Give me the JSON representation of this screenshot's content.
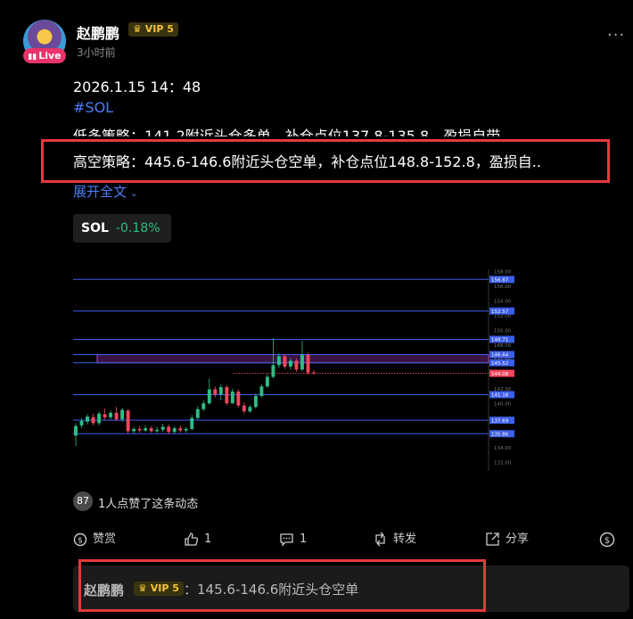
{
  "post": {
    "username": "赵鹏鹏",
    "vip": "VIP 5",
    "vip_icon": "crown-icon",
    "live_label": "Live",
    "time": "3小时前",
    "date_line": "2026.1.15 14：48",
    "hashtag": "#SOL",
    "line_long": "低多策略：141.2附近头仓多单，补仓点位137.8-135.8，盈损自带",
    "line_short": "高空策略：445.6-146.6附近头仓空单，补仓点位148.8-152.8，盈损自..",
    "expand": "展开全文",
    "ticker_symbol": "SOL",
    "ticker_change": "-0.18%",
    "likes_count": "87",
    "likes_text": "1人点赞了这条动态"
  },
  "actions": {
    "reward": "赞赏",
    "like": "1",
    "comment": "1",
    "repost": "转发",
    "share": "分享"
  },
  "comment": {
    "user": "赵鹏鹏",
    "vip": "VIP 5",
    "text": "：145.6-146.6附近头仓空单"
  },
  "colors": {
    "accent": "#4d7cf6",
    "up": "#2ebd85",
    "down": "#f6465d",
    "highlight_box": "#e43a3a",
    "vip": "#f4c23d"
  },
  "chart_data": {
    "type": "candlestick",
    "ylim": [
      132,
      158
    ],
    "y_ticks": [
      "158.00",
      "156.00",
      "154.00",
      "152.00",
      "150.00",
      "148.00",
      "146.00",
      "144.00",
      "142.00",
      "140.00",
      "138.00",
      "136.00",
      "134.00",
      "132.00"
    ],
    "levels": [
      {
        "value": 156.87,
        "label": "156.87"
      },
      {
        "value": 152.57,
        "label": "152.57"
      },
      {
        "value": 148.71,
        "label": "148.71"
      },
      {
        "value": 146.64,
        "label": "146.64"
      },
      {
        "value": 145.52,
        "label": "145.52"
      },
      {
        "value": 144.08,
        "label": "144.08"
      },
      {
        "value": 141.18,
        "label": "141.18"
      },
      {
        "value": 137.69,
        "label": "137.69"
      },
      {
        "value": 135.86,
        "label": "135.86"
      }
    ],
    "current_price": 144.08,
    "zone": [
      145.52,
      146.64
    ],
    "candles": [
      [
        135.6,
        136.9,
        137.3,
        134.2
      ],
      [
        137.0,
        137.6,
        138.0,
        136.6
      ],
      [
        137.5,
        138.2,
        138.5,
        137.1
      ],
      [
        138.1,
        137.3,
        138.6,
        137.0
      ],
      [
        137.3,
        138.6,
        138.9,
        137.0
      ],
      [
        138.5,
        138.1,
        139.3,
        137.8
      ],
      [
        138.1,
        138.7,
        139.0,
        137.8
      ],
      [
        138.7,
        137.8,
        139.5,
        137.6
      ],
      [
        137.8,
        139.1,
        139.4,
        137.5
      ],
      [
        139.0,
        136.2,
        139.2,
        135.9
      ],
      [
        136.2,
        136.5,
        136.8,
        135.9
      ],
      [
        136.5,
        136.3,
        136.9,
        136.0
      ],
      [
        136.3,
        136.6,
        137.0,
        136.1
      ],
      [
        136.6,
        136.2,
        136.9,
        136.0
      ],
      [
        136.2,
        136.4,
        136.8,
        136.0
      ],
      [
        136.4,
        136.8,
        137.2,
        136.1
      ],
      [
        136.8,
        136.1,
        137.1,
        135.8
      ],
      [
        136.1,
        136.6,
        136.9,
        135.9
      ],
      [
        136.6,
        136.3,
        137.0,
        136.0
      ],
      [
        136.3,
        136.5,
        136.8,
        136.0
      ],
      [
        136.5,
        138.0,
        138.4,
        136.3
      ],
      [
        138.0,
        139.2,
        139.6,
        137.8
      ],
      [
        139.2,
        140.0,
        140.4,
        138.9
      ],
      [
        140.0,
        141.9,
        143.4,
        139.8
      ],
      [
        141.9,
        141.2,
        142.3,
        140.8
      ],
      [
        141.2,
        142.2,
        142.6,
        140.4
      ],
      [
        142.2,
        140.0,
        142.5,
        139.7
      ],
      [
        140.0,
        141.6,
        142.0,
        139.9
      ],
      [
        141.6,
        139.7,
        141.9,
        139.4
      ],
      [
        139.7,
        138.9,
        140.1,
        138.6
      ],
      [
        138.9,
        139.5,
        139.8,
        138.7
      ],
      [
        139.5,
        141.0,
        141.3,
        139.3
      ],
      [
        141.0,
        142.3,
        142.6,
        140.8
      ],
      [
        142.3,
        143.6,
        144.0,
        142.1
      ],
      [
        143.6,
        145.2,
        148.9,
        143.4
      ],
      [
        145.2,
        146.4,
        146.8,
        144.8
      ],
      [
        146.4,
        145.0,
        146.7,
        144.7
      ],
      [
        145.0,
        145.8,
        146.2,
        144.6
      ],
      [
        145.8,
        144.6,
        146.1,
        144.3
      ],
      [
        144.6,
        146.6,
        148.5,
        144.4
      ],
      [
        146.6,
        144.2,
        146.9,
        143.9
      ],
      [
        144.2,
        144.1,
        144.5,
        143.9
      ]
    ]
  }
}
